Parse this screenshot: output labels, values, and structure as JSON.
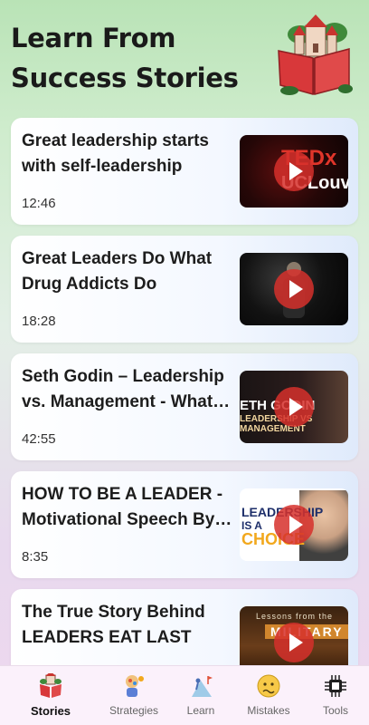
{
  "header": {
    "title_line1": "Learn From",
    "title_line2": "Success Stories",
    "illustration_icon": "storybook-castle-icon"
  },
  "videos": [
    {
      "title": "Great leadership starts with self-leadership",
      "duration": "12:46",
      "thumb_text": [
        "TEDx",
        "UCLouv"
      ]
    },
    {
      "title": "Great Leaders Do What Drug Addicts Do",
      "duration": "18:28",
      "thumb_text": []
    },
    {
      "title": "Seth Godin – Leadership vs. Management - What…",
      "duration": "42:55",
      "thumb_text": [
        "ETH GODIN",
        "LEADERSHIP VS MANAGEMENT"
      ]
    },
    {
      "title": "HOW TO BE A LEADER - Motivational Speech By…",
      "duration": "8:35",
      "thumb_text": [
        "LEADERSHIP",
        "IS A",
        "CHOICE"
      ]
    },
    {
      "title": "The True Story Behind LEADERS EAT LAST",
      "duration": "",
      "thumb_text": [
        "Lessons from the",
        "MILITARY"
      ]
    }
  ],
  "tabs": [
    {
      "label": "Stories",
      "icon": "storybook-icon",
      "active": true
    },
    {
      "label": "Strategies",
      "icon": "strategy-icon",
      "active": false
    },
    {
      "label": "Learn",
      "icon": "climbing-icon",
      "active": false
    },
    {
      "label": "Mistakes",
      "icon": "worried-face-icon",
      "active": false
    },
    {
      "label": "Tools",
      "icon": "tools-icon",
      "active": false
    }
  ],
  "colors": {
    "play_button": "#d6302b",
    "tab_background": "#fbf1fb",
    "page_gradient_top": "#b9e3b6",
    "page_gradient_bottom": "#eed8ef"
  }
}
